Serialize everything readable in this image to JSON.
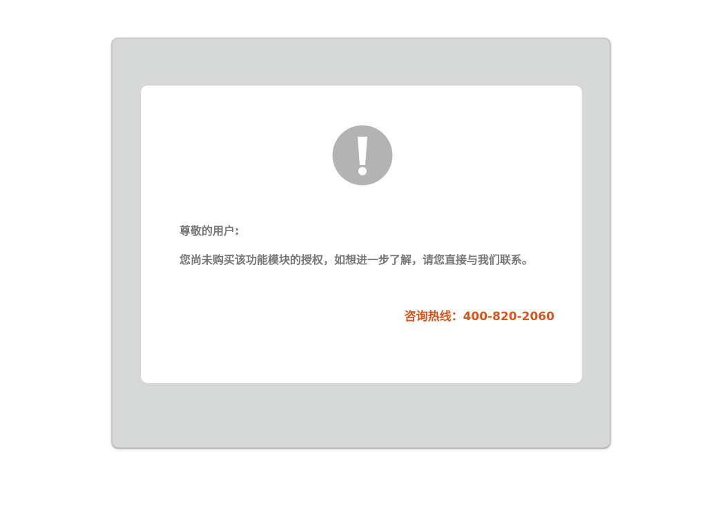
{
  "notice": {
    "icon": "exclamation-circle-icon",
    "greeting": "尊敬的用户:",
    "message": "您尚未购买该功能模块的授权，如想进一步了解，请您直接与我们联系。",
    "hotline": "咨询热线：400-820-2060"
  },
  "colors": {
    "outer_panel": "#d6d7d7",
    "card": "#ffffff",
    "icon": "#b3b3b3",
    "text": "#777777",
    "hotline": "#d9541a"
  }
}
